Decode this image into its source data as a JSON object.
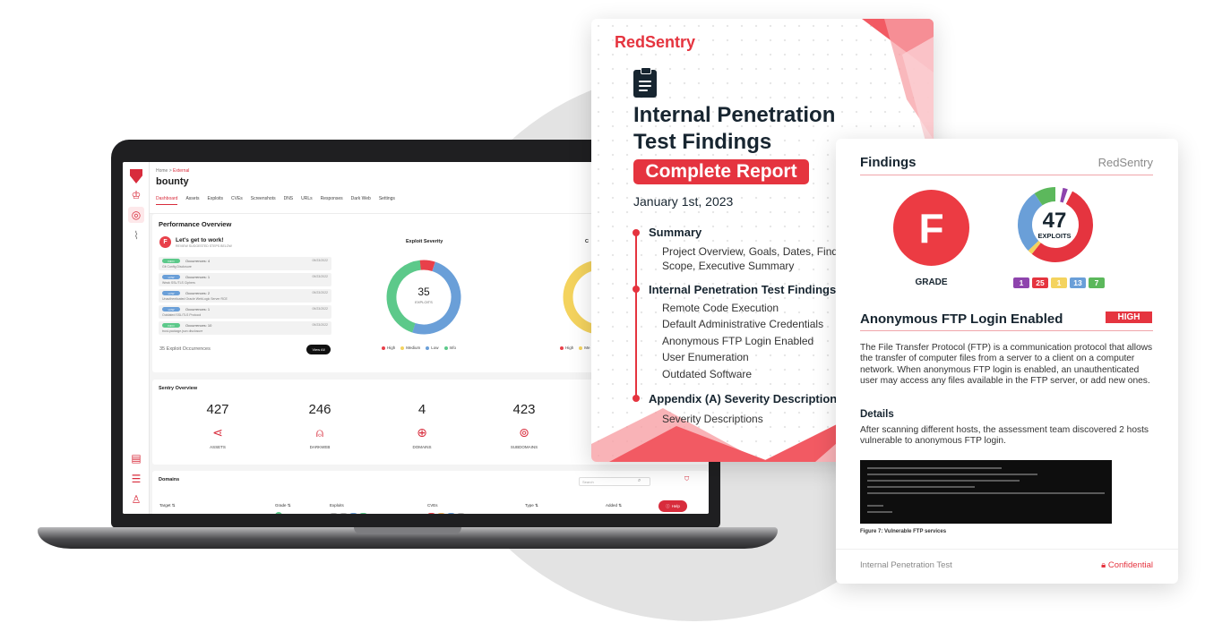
{
  "app": {
    "breadcrumb_home": "Home",
    "breadcrumb_sep": ">",
    "breadcrumb_current": "External",
    "title": "bounty",
    "tabs": [
      "Dashboard",
      "Assets",
      "Exploits",
      "CVEs",
      "Screenshots",
      "DNS",
      "URLs",
      "Responses",
      "Dark Web",
      "Settings"
    ],
    "active_tab": "Dashboard",
    "performance": {
      "title": "Performance Overview",
      "badge_letter": "F",
      "heading": "Let's get to work!",
      "subheading": "REVIEW SUGGESTED STEPS BELOW",
      "occurrences": [
        {
          "level": "INFO",
          "color": "#5cc98a",
          "count": "Occurrences: 4",
          "date": "09/23/2022",
          "text": "Git Config Disclosure"
        },
        {
          "level": "LOW",
          "color": "#6a9fd8",
          "count": "Occurrences: 1",
          "date": "09/23/2022",
          "text": "Weak SSL/TLS Ciphers"
        },
        {
          "level": "LOW",
          "color": "#6a9fd8",
          "count": "Occurrences: 2",
          "date": "09/23/2022",
          "text": "Unauthenticated Oracle WebLogic Server RCE"
        },
        {
          "level": "LOW",
          "color": "#6a9fd8",
          "count": "Occurrences: 1",
          "date": "09/23/2022",
          "text": "Outdated SSL/TLS Protocol"
        },
        {
          "level": "INFO",
          "color": "#5cc98a",
          "count": "Occurrences: 10",
          "date": "09/23/2022",
          "text": "trust-package.json disclosure"
        }
      ],
      "footer": "35 Exploit Occurrences",
      "view_all": "View All",
      "exploit_severity_title": "Exploit Severity",
      "second_chart_title_partial": "C",
      "donut_center_value": "35",
      "donut_center_label": "EXPLOITS",
      "legend": [
        {
          "name": "High",
          "color": "#e8404a"
        },
        {
          "name": "Medium",
          "color": "#f4d35e"
        },
        {
          "name": "Low",
          "color": "#6a9fd8"
        },
        {
          "name": "Info",
          "color": "#5cc98a"
        }
      ],
      "legend_partial": [
        "High",
        "Me"
      ]
    },
    "sentry": {
      "title": "Sentry Overview",
      "stats": [
        {
          "value": "427",
          "label": "ASSETS",
          "icon": "share-nodes-icon"
        },
        {
          "value": "246",
          "label": "DARKWEB",
          "icon": "hacker-icon"
        },
        {
          "value": "4",
          "label": "DOMAINS",
          "icon": "globe-icon"
        },
        {
          "value": "423",
          "label": "SUBDOMAINS",
          "icon": "network-icon"
        }
      ]
    },
    "domains": {
      "title": "Domains",
      "search_placeholder": "Search",
      "columns": [
        "Target ⇅",
        "Grade ⇅",
        "Exploits",
        "CVEs",
        "Type ⇅",
        "Added ⇅"
      ],
      "help": "Help"
    }
  },
  "cover": {
    "logo": "RedSentry",
    "title_line1": "Internal Penetration",
    "title_line2": "Test Findings",
    "badge": "Complete Report",
    "date": "January 1st, 2023",
    "sections": [
      {
        "title": "Summary",
        "items": [
          "Project Overview, Goals, Dates, Findings,",
          "Scope, Executive Summary"
        ]
      },
      {
        "title": "Internal Penetration Test Findings",
        "items": [
          "Remote Code Execution",
          "Default Administrative Credentials",
          "Anonymous FTP Login Enabled",
          "User Enumeration",
          "Outdated Software"
        ]
      },
      {
        "title": "Appendix (A) Severity Description",
        "items": [
          "Severity Descriptions"
        ]
      }
    ]
  },
  "findings": {
    "title": "Findings",
    "logo": "RedSentry",
    "grade": "F",
    "grade_label": "GRADE",
    "exploits_value": "47",
    "exploits_label": "EXPLOITS",
    "severity_counts": [
      {
        "value": "1",
        "color": "#8e44ad"
      },
      {
        "value": "25",
        "color": "#e5343f"
      },
      {
        "value": "1",
        "color": "#f4d35e"
      },
      {
        "value": "13",
        "color": "#6a9fd8"
      },
      {
        "value": "7",
        "color": "#5cb85c"
      }
    ],
    "finding_title": "Anonymous FTP Login Enabled",
    "finding_severity": "HIGH",
    "description": "The File Transfer Protocol (FTP) is a communication protocol that allows the transfer of computer files from a server to a client on a computer network. When anonymous FTP login is enabled, an unauthenticated user may access any files available in the FTP server, or add new ones.",
    "details_heading": "Details",
    "details_text": "After scanning different hosts, the assessment team discovered 2 hosts vulnerable to anonymous FTP login.",
    "figure_caption": "Figure 7: Vulnerable FTP services",
    "footer_left": "Internal Penetration Test",
    "footer_right": "Confidential",
    "lock_icon": "lock-icon"
  }
}
